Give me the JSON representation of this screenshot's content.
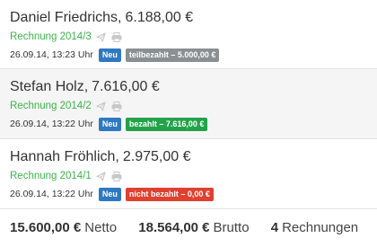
{
  "invoices": [
    {
      "name": "Daniel Friedrichs,",
      "amount": "6.188,00 €",
      "invoice_ref": "Rechnung 2014/3",
      "icons": [
        "send-icon",
        "print-icon"
      ],
      "datetime": "26.09.14, 13:23 Uhr",
      "new_badge": "Neu",
      "status_badge": "teilbezahlt – 5.000,00 €",
      "status_color": "#8a8f91"
    },
    {
      "name": "Stefan Holz,",
      "amount": "7.616,00 €",
      "invoice_ref": "Rechnung 2014/2",
      "icons": [
        "send-icon",
        "print-icon"
      ],
      "datetime": "26.09.14, 13:22 Uhr",
      "new_badge": "Neu",
      "status_badge": "bezahlt – 7.616,00 €",
      "status_color": "#23a24a"
    },
    {
      "name": "Hannah Fröhlich,",
      "amount": "2.975,00 €",
      "invoice_ref": "Rechnung 2014/1",
      "icons": [
        "send-icon",
        "print-icon"
      ],
      "datetime": "26.09.14, 13:22 Uhr",
      "new_badge": "Neu",
      "status_badge": "nicht bezahlt – 0,00 €",
      "status_color": "#e0402f"
    }
  ],
  "summary": {
    "netto_value": "15.600,00 €",
    "netto_label": "Netto",
    "brutto_value": "18.564,00 €",
    "brutto_label": "Brutto",
    "count_value": "4",
    "count_label": "Rechnungen"
  },
  "colors": {
    "link_green": "#3cb54a",
    "badge_new": "#2f78c2",
    "row_alt_background": "#f5f5f5"
  }
}
